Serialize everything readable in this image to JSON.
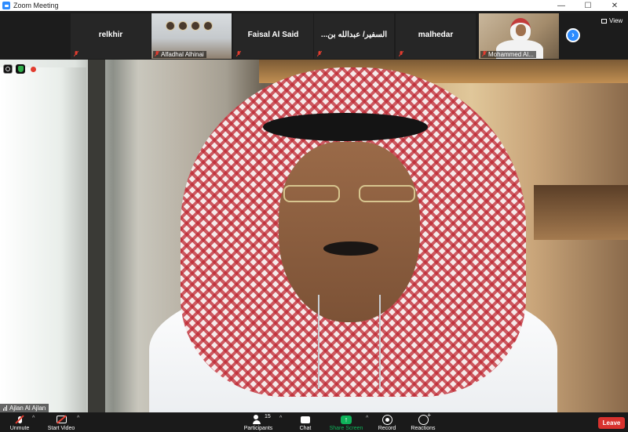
{
  "window": {
    "title": "Zoom Meeting",
    "controls": {
      "minimize": "—",
      "maximize": "☐",
      "close": "✕"
    }
  },
  "gallery": {
    "tiles": [
      {
        "name": "relkhir",
        "type": "name",
        "muted": true
      },
      {
        "name": "Alfadhal Alhinai",
        "type": "video",
        "muted": true
      },
      {
        "name": "Faisal Al Said",
        "type": "name",
        "muted": true
      },
      {
        "name": "...السفير/ عبدالله بن",
        "type": "name",
        "muted": true
      },
      {
        "name": "malhedar",
        "type": "name",
        "muted": true
      },
      {
        "name": "Mohammed Al...",
        "type": "video",
        "muted": true
      }
    ],
    "next_icon": "chevron-right-icon",
    "next_glyph": "›",
    "view_label": "View"
  },
  "main_video": {
    "speaker_name": "Ajlan Al Ajlan",
    "overlay_icons": [
      "info-icon",
      "shield-icon",
      "recording-icon"
    ]
  },
  "toolbar": {
    "unmute_label": "Unmute",
    "start_video_label": "Start Video",
    "participants_label": "Participants",
    "participants_count": "15",
    "chat_label": "Chat",
    "share_screen_label": "Share Screen",
    "record_label": "Record",
    "reactions_label": "Reactions",
    "leave_label": "Leave",
    "caret": "^"
  },
  "colors": {
    "accent_blue": "#2d8cff",
    "share_green": "#0fb35a",
    "leave_red": "#d8322e",
    "muted_red": "#e23c2f",
    "toolbar_bg": "#1a1a1a"
  }
}
